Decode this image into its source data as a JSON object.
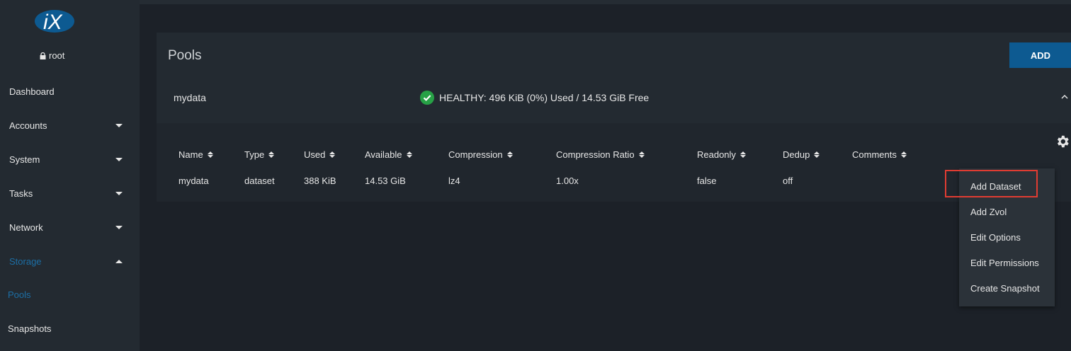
{
  "sidebar": {
    "logo_text": "iX",
    "user": "root",
    "items": [
      {
        "label": "Dashboard"
      },
      {
        "label": "Accounts"
      },
      {
        "label": "System"
      },
      {
        "label": "Tasks"
      },
      {
        "label": "Network"
      },
      {
        "label": "Storage"
      }
    ],
    "subitems": [
      {
        "label": "Pools"
      },
      {
        "label": "Snapshots"
      }
    ]
  },
  "main": {
    "title": "Pools",
    "add_label": "ADD",
    "pool": {
      "name": "mydata",
      "status": "HEALTHY: 496 KiB (0%) Used / 14.53 GiB Free"
    },
    "table": {
      "headers": [
        "Name",
        "Type",
        "Used",
        "Available",
        "Compression",
        "Compression Ratio",
        "Readonly",
        "Dedup",
        "Comments"
      ],
      "row": [
        "mydata",
        "dataset",
        "388 KiB",
        "14.53 GiB",
        "lz4",
        "1.00x",
        "false",
        "off",
        ""
      ]
    }
  },
  "menu": {
    "items": [
      "Add Dataset",
      "Add Zvol",
      "Edit Options",
      "Edit Permissions",
      "Create Snapshot"
    ]
  },
  "colors": {
    "accent": "#0d5a91",
    "active_nav": "#1c6fa6",
    "healthy": "#27a146",
    "highlight": "#e03c32"
  }
}
